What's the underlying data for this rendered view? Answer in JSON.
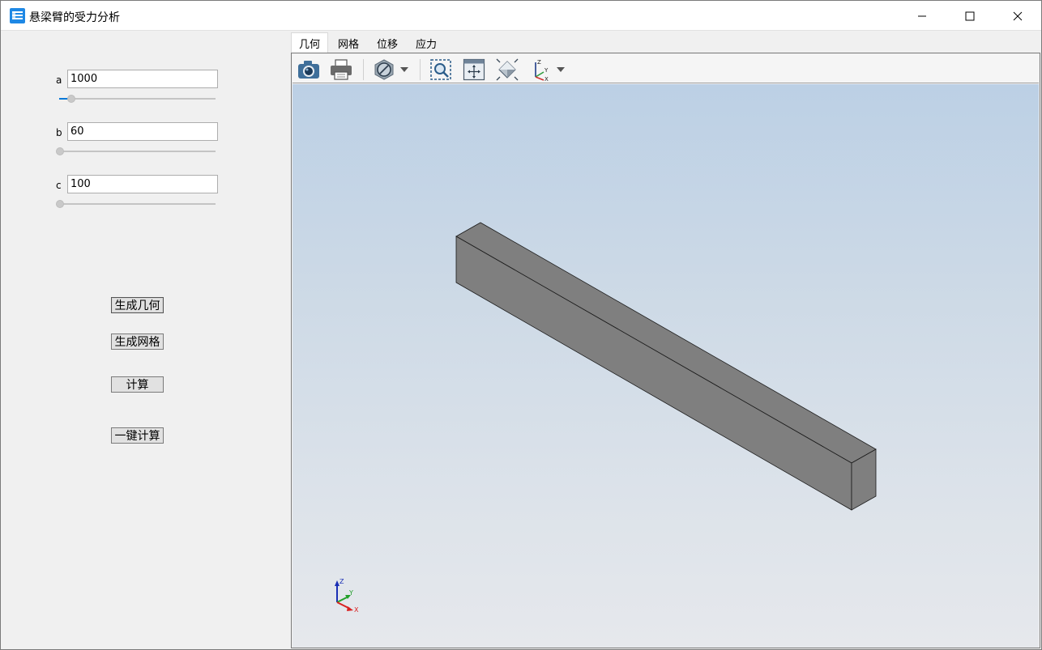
{
  "window": {
    "title": "悬梁臂的受力分析",
    "icon": "app-grid-icon",
    "controls": [
      "minimize-icon",
      "maximize-icon",
      "close-icon"
    ]
  },
  "params": [
    {
      "label": "a",
      "value": "1000",
      "slider_fraction": 0.08
    },
    {
      "label": "b",
      "value": "60",
      "slider_fraction": 0.0
    },
    {
      "label": "c",
      "value": "100",
      "slider_fraction": 0.0
    }
  ],
  "buttons": {
    "gen_geometry": "生成几何",
    "gen_mesh": "生成网格",
    "compute": "计算",
    "one_click": "一键计算"
  },
  "tabs": [
    "几何",
    "网格",
    "位移",
    "应力"
  ],
  "active_tab": "几何",
  "toolbar": [
    "camera-icon",
    "print-icon",
    "clip-plane-icon",
    "dropdown-arrow-icon",
    "zoom-window-icon",
    "fit-all-icon",
    "view-iso-icon",
    "axes-triad-icon",
    "dropdown-arrow-icon"
  ],
  "triad": {
    "x": "X",
    "y": "Y",
    "z": "Z"
  },
  "colors": {
    "beam": "#808080",
    "viewport_top": "#bcd0e5",
    "viewport_bottom": "#e6e8ec",
    "accent": "#0078d7"
  }
}
